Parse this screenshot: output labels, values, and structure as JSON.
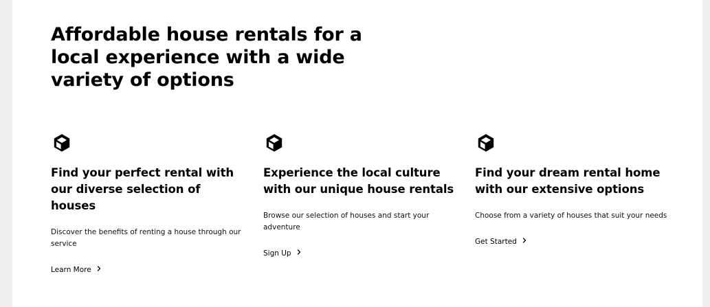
{
  "headline": "Affordable house rentals for a local experience with a wide variety of options",
  "features": [
    {
      "icon": "cube-icon",
      "title": "Find your perfect rental with our diverse selection of houses",
      "description": "Discover the benefits of renting a house through our service",
      "link_label": "Learn More",
      "link_icon": "chevron-right-icon"
    },
    {
      "icon": "cube-icon",
      "title": "Experience the local culture with our unique house rentals",
      "description": "Browse our selection of houses and start your adventure",
      "link_label": "Sign Up",
      "link_icon": "chevron-right-icon"
    },
    {
      "icon": "cube-icon",
      "title": "Find your dream rental home with our extensive options",
      "description": "Choose from a variety of houses that suit your needs",
      "link_label": "Get Started",
      "link_icon": "chevron-right-icon"
    }
  ],
  "colors": {
    "background": "#efeeec",
    "surface": "#ffffff",
    "text": "#000000"
  }
}
